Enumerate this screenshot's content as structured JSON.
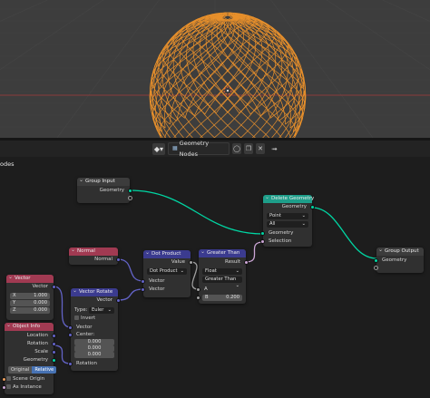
{
  "node_editor": {
    "tree_type_icon": "geometry-nodes-icon",
    "tree_name": "Geometry Nodes",
    "editor_label": "odes"
  },
  "nodes": {
    "group_input": {
      "title": "Group Input",
      "geometry": "Geometry"
    },
    "delete_geometry": {
      "title": "Delete Geometry",
      "geometry_out": "Geometry",
      "domain": "Point",
      "mode": "All",
      "geometry_in": "Geometry",
      "selection": "Selection"
    },
    "group_output": {
      "title": "Group Output",
      "geometry": "Geometry"
    },
    "normal": {
      "title": "Normal",
      "normal": "Normal"
    },
    "dot_product": {
      "title": "Dot Product",
      "value": "Value",
      "operation": "Dot Product",
      "vector1": "Vector",
      "vector2": "Vector"
    },
    "greater_than": {
      "title": "Greater Than",
      "result": "Result",
      "data_type": "Float",
      "mode": "Greater Than",
      "a": "A",
      "b_label": "B",
      "b_value": "0.200"
    },
    "vector": {
      "title": "Vector",
      "vector": "Vector",
      "x": "X",
      "y": "Y",
      "z": "Z",
      "x_val": "1.000",
      "y_val": "0.000",
      "z_val": "0.000"
    },
    "vector_rotate": {
      "title": "Vector Rotate",
      "vector_out": "Vector",
      "type_label": "Type:",
      "type_value": "Euler",
      "invert": "Invert",
      "vector_in": "Vector",
      "center": "Center:",
      "c1": "0.000",
      "c2": "0.000",
      "c3": "0.000",
      "rotation": "Rotation"
    },
    "object_info": {
      "title": "Object Info",
      "location": "Location",
      "rotation": "Rotation",
      "scale": "Scale",
      "geometry": "Geometry",
      "original": "Original",
      "relative": "Relative",
      "scene_origin": "Scene Origin",
      "as_instance": "As Instance"
    }
  },
  "colors": {
    "viewport_bg": "#3d3d3d",
    "editor_bg": "#1d1d1d",
    "geometry_socket": "#00d6a3",
    "vector_socket": "#6363c7",
    "float_socket": "#a1a1a1",
    "boolean_socket": "#cca6d6",
    "geometry_header": "#1e9e8a",
    "input_header": "#a13a52",
    "converter_header": "#3b3b8f",
    "object_selection": "#f2952b"
  }
}
